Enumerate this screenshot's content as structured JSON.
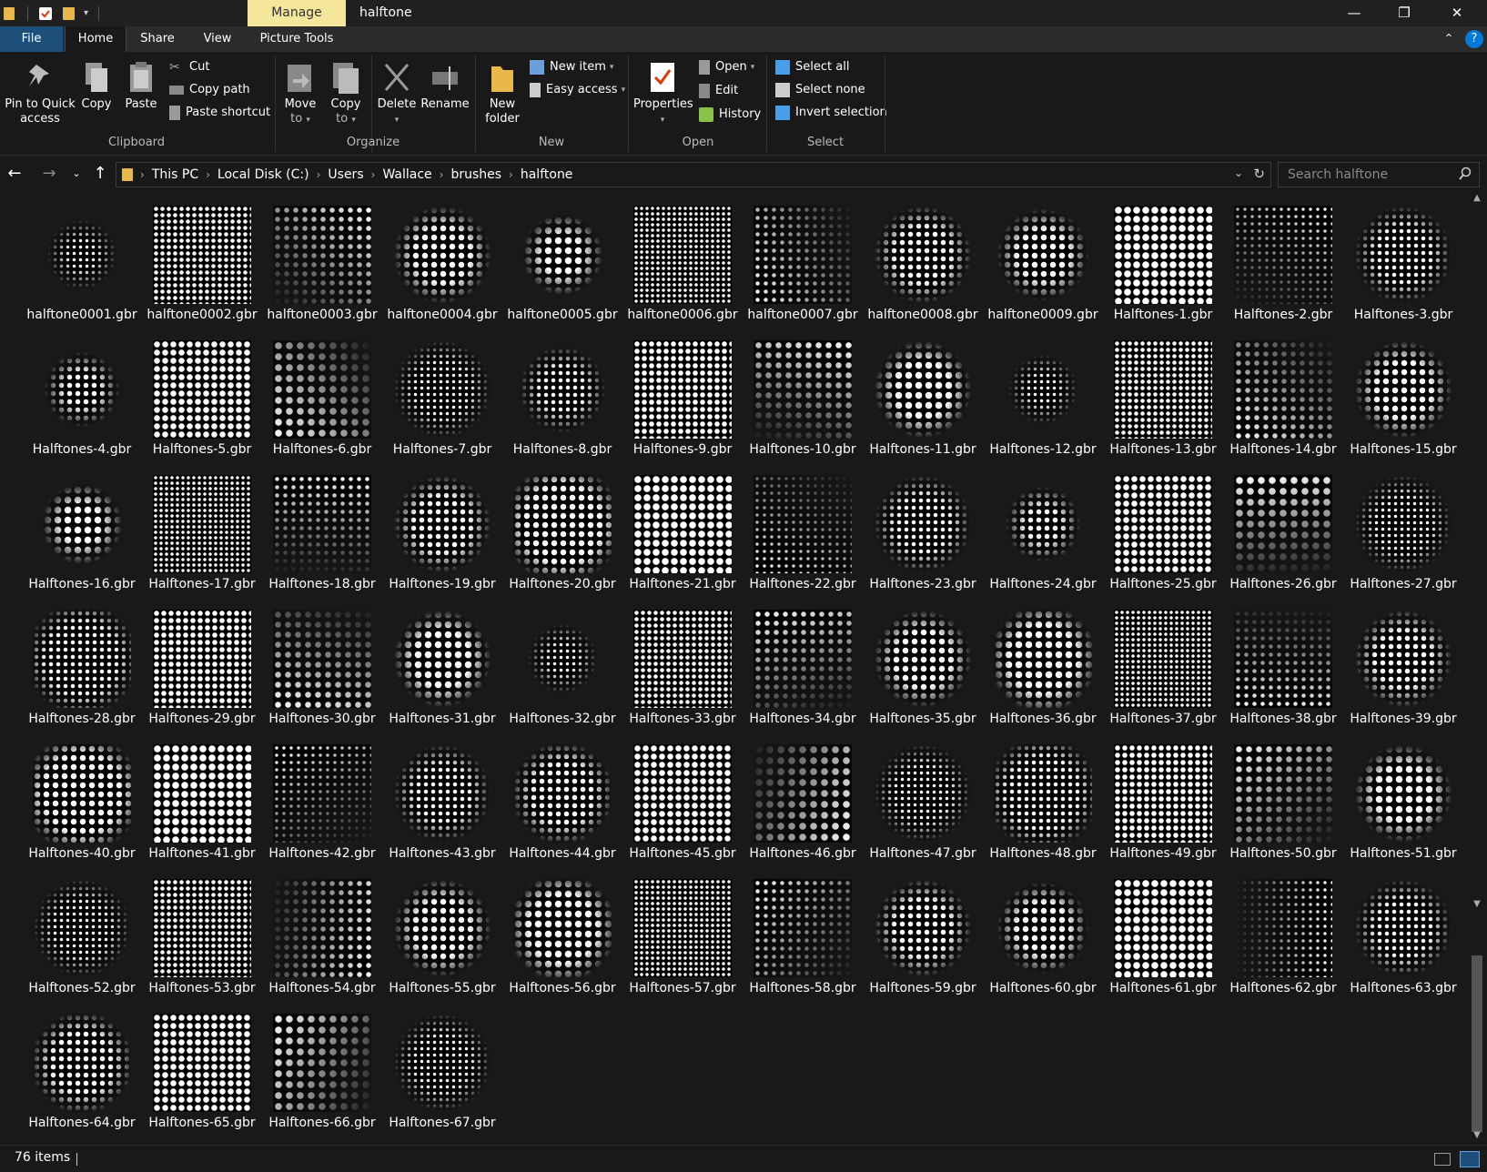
{
  "window": {
    "title": "halftone",
    "context_tab": "Manage",
    "minimize_glyph": "—",
    "maximize_glyph": "❐",
    "close_glyph": "✕"
  },
  "tabs": {
    "file": "File",
    "home": "Home",
    "share": "Share",
    "view": "View",
    "picture_tools": "Picture Tools"
  },
  "ribbon": {
    "clipboard": {
      "pin_line1": "Pin to Quick",
      "pin_line2": "access",
      "copy": "Copy",
      "paste": "Paste",
      "cut": "Cut",
      "copy_path": "Copy path",
      "paste_shortcut": "Paste shortcut",
      "group": "Clipboard"
    },
    "organize": {
      "move_line1": "Move",
      "move_line2": "to",
      "copy_line1": "Copy",
      "copy_line2": "to",
      "delete": "Delete",
      "rename": "Rename",
      "group": "Organize"
    },
    "new": {
      "folder_line1": "New",
      "folder_line2": "folder",
      "new_item": "New item",
      "easy_access": "Easy access",
      "group": "New"
    },
    "open": {
      "properties": "Properties",
      "open": "Open",
      "edit": "Edit",
      "history": "History",
      "group": "Open"
    },
    "select": {
      "select_all": "Select all",
      "select_none": "Select none",
      "invert_selection": "Invert selection",
      "group": "Select"
    }
  },
  "address": {
    "crumbs": [
      "This PC",
      "Local Disk (C:)",
      "Users",
      "Wallace",
      "brushes",
      "halftone"
    ],
    "search_placeholder": "Search halftone"
  },
  "files": [
    "halftone0001.gbr",
    "halftone0002.gbr",
    "halftone0003.gbr",
    "halftone0004.gbr",
    "halftone0005.gbr",
    "halftone0006.gbr",
    "halftone0007.gbr",
    "halftone0008.gbr",
    "halftone0009.gbr",
    "Halftones-1.gbr",
    "Halftones-2.gbr",
    "Halftones-3.gbr",
    "Halftones-4.gbr",
    "Halftones-5.gbr",
    "Halftones-6.gbr",
    "Halftones-7.gbr",
    "Halftones-8.gbr",
    "Halftones-9.gbr",
    "Halftones-10.gbr",
    "Halftones-11.gbr",
    "Halftones-12.gbr",
    "Halftones-13.gbr",
    "Halftones-14.gbr",
    "Halftones-15.gbr",
    "Halftones-16.gbr",
    "Halftones-17.gbr",
    "Halftones-18.gbr",
    "Halftones-19.gbr",
    "Halftones-20.gbr",
    "Halftones-21.gbr",
    "Halftones-22.gbr",
    "Halftones-23.gbr",
    "Halftones-24.gbr",
    "Halftones-25.gbr",
    "Halftones-26.gbr",
    "Halftones-27.gbr",
    "Halftones-28.gbr",
    "Halftones-29.gbr",
    "Halftones-30.gbr",
    "Halftones-31.gbr",
    "Halftones-32.gbr",
    "Halftones-33.gbr",
    "Halftones-34.gbr",
    "Halftones-35.gbr",
    "Halftones-36.gbr",
    "Halftones-37.gbr",
    "Halftones-38.gbr",
    "Halftones-39.gbr",
    "Halftones-40.gbr",
    "Halftones-41.gbr",
    "Halftones-42.gbr",
    "Halftones-43.gbr",
    "Halftones-44.gbr",
    "Halftones-45.gbr",
    "Halftones-46.gbr",
    "Halftones-47.gbr",
    "Halftones-48.gbr",
    "Halftones-49.gbr",
    "Halftones-50.gbr",
    "Halftones-51.gbr",
    "Halftones-52.gbr",
    "Halftones-53.gbr",
    "Halftones-54.gbr",
    "Halftones-55.gbr",
    "Halftones-56.gbr",
    "Halftones-57.gbr",
    "Halftones-58.gbr",
    "Halftones-59.gbr",
    "Halftones-60.gbr",
    "Halftones-61.gbr",
    "Halftones-62.gbr",
    "Halftones-63.gbr",
    "Halftones-64.gbr",
    "Halftones-65.gbr",
    "Halftones-66.gbr",
    "Halftones-67.gbr"
  ],
  "status": {
    "items_count": "76 items"
  },
  "colors": {
    "background": "#191919",
    "manage_tab": "#f4e79b",
    "file_tab": "#1e4f7a",
    "accent": "#0078d7"
  }
}
